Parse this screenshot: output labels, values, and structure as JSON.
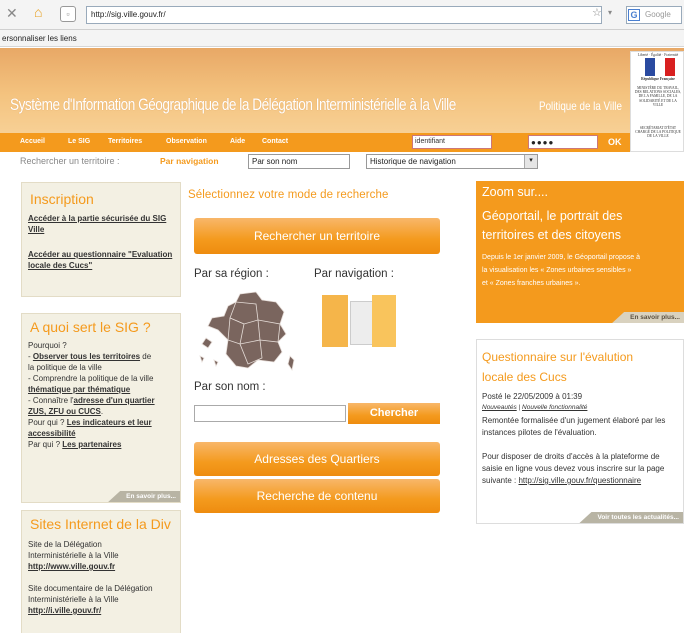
{
  "browser": {
    "url": "http://sig.ville.gouv.fr/",
    "search_placeholder": "Google",
    "search_engine": "G",
    "bookmarks_text": "ersonnaliser les liens"
  },
  "banner": {
    "title": "Système d'Information Géographique de la Délégation Interministérielle à la Ville",
    "subtitle": "Politique de la Ville",
    "gov_header": "Liberté · Égalité · Fraternité",
    "gov_country": "République Française",
    "gov_ministry": "MINISTÈRE DU TRAVAIL, DES RELATIONS SOCIALES, DE LA FAMILLE, DE LA SOLIDARITÉ ET DE LA VILLE",
    "gov_secretariat": "SECRÉTARIAT D'ÉTAT CHARGÉ DE LA POLITIQUE DE LA VILLE"
  },
  "nav": {
    "items": [
      "Accueil",
      "Le SIG",
      "Territoires",
      "Observation",
      "Aide",
      "Contact"
    ],
    "login_value": "identifiant",
    "password_value": "●●●●",
    "ok_label": "OK"
  },
  "search_bar": {
    "label": "Rechercher un territoire :",
    "nav_tab": "Par navigation",
    "byname_value": "Par son nom",
    "history_value": "Historique de navigation",
    "history_arrow": "▾"
  },
  "inscription": {
    "title": "Inscription",
    "link1": "Accéder à la partie sécurisée du SIG Ville",
    "link2": "Accéder au questionnaire \"Evaluation locale des Cucs\""
  },
  "about": {
    "title": "A quoi sert le SIG ?",
    "l1": "Pourquoi ?",
    "l2a": "- ",
    "l2b": "Observer tous les territoires",
    "l2c": " de",
    "l3": "la politique de la ville",
    "l4": "- Comprendre la politique de la ville",
    "l5": "thématique par thématique",
    "l6a": "- Connaître l'",
    "l6b": "adresse d'un quartier",
    "l7": "ZUS, ZFU ou CUCS",
    "l7b": ".",
    "l8a": "Pour qui ? ",
    "l8b": "Les indicateurs et leur",
    "l9": "accessibilité",
    "l10a": "Par qui ? ",
    "l10b": "Les partenaires",
    "more": "En savoir plus..."
  },
  "sites": {
    "title": "Sites Internet de la Div",
    "l1": "Site de la Délégation",
    "l2": "Interministérielle à la Ville",
    "l3": "http://www.ville.gouv.fr",
    "l4": "Site documentaire de la Délégation",
    "l5": "Interministérielle à la Ville",
    "l6": "http://i.ville.gouv.fr/"
  },
  "middle": {
    "title": "Sélectionnez votre mode de recherche",
    "territory_button": "Rechercher un territoire",
    "region_label": "Par sa région :",
    "navigation_label": "Par navigation :",
    "name_label": "Par son nom :",
    "search_button": "Chercher",
    "addresses_button": "Adresses des Quartiers",
    "content_button": "Recherche de contenu"
  },
  "zoom": {
    "title": "Zoom sur....",
    "headline1": "Géoportail, le portrait des",
    "headline2": "territoires et des citoyens",
    "b1": "Depuis le 1er janvier 2009, le Géoportail propose à",
    "b2": "la visualisation les « Zones urbaines sensibles »",
    "b3": "et « Zones franches urbaines ».",
    "more": "En savoir plus..."
  },
  "questionnaire": {
    "title1": "Questionnaire sur l'évalution",
    "title2": "locale des Cucs",
    "date": "Posté le 22/05/2009 à 01:39",
    "tags_a": "Nouveautés",
    "tags_sep": " | ",
    "tags_b": "Nouvelle fonctionnalité",
    "p1": "Remontée formalisée d'un jugement élaboré par les",
    "p2": "instances pilotes de l'évaluation.",
    "p3": "Pour disposer de droits d'accès à la plateforme de",
    "p4": "saisie en ligne vous devez vous inscrire sur la page",
    "p5a": "suivante : ",
    "p5b": "http://sig.ville.gouv.fr/questionnaire",
    "more": "Voir toutes les actualités..."
  },
  "colors": {
    "accent": "#f49a1d",
    "panel_bg": "#f3f0e3",
    "banner": "#f4c37f"
  }
}
